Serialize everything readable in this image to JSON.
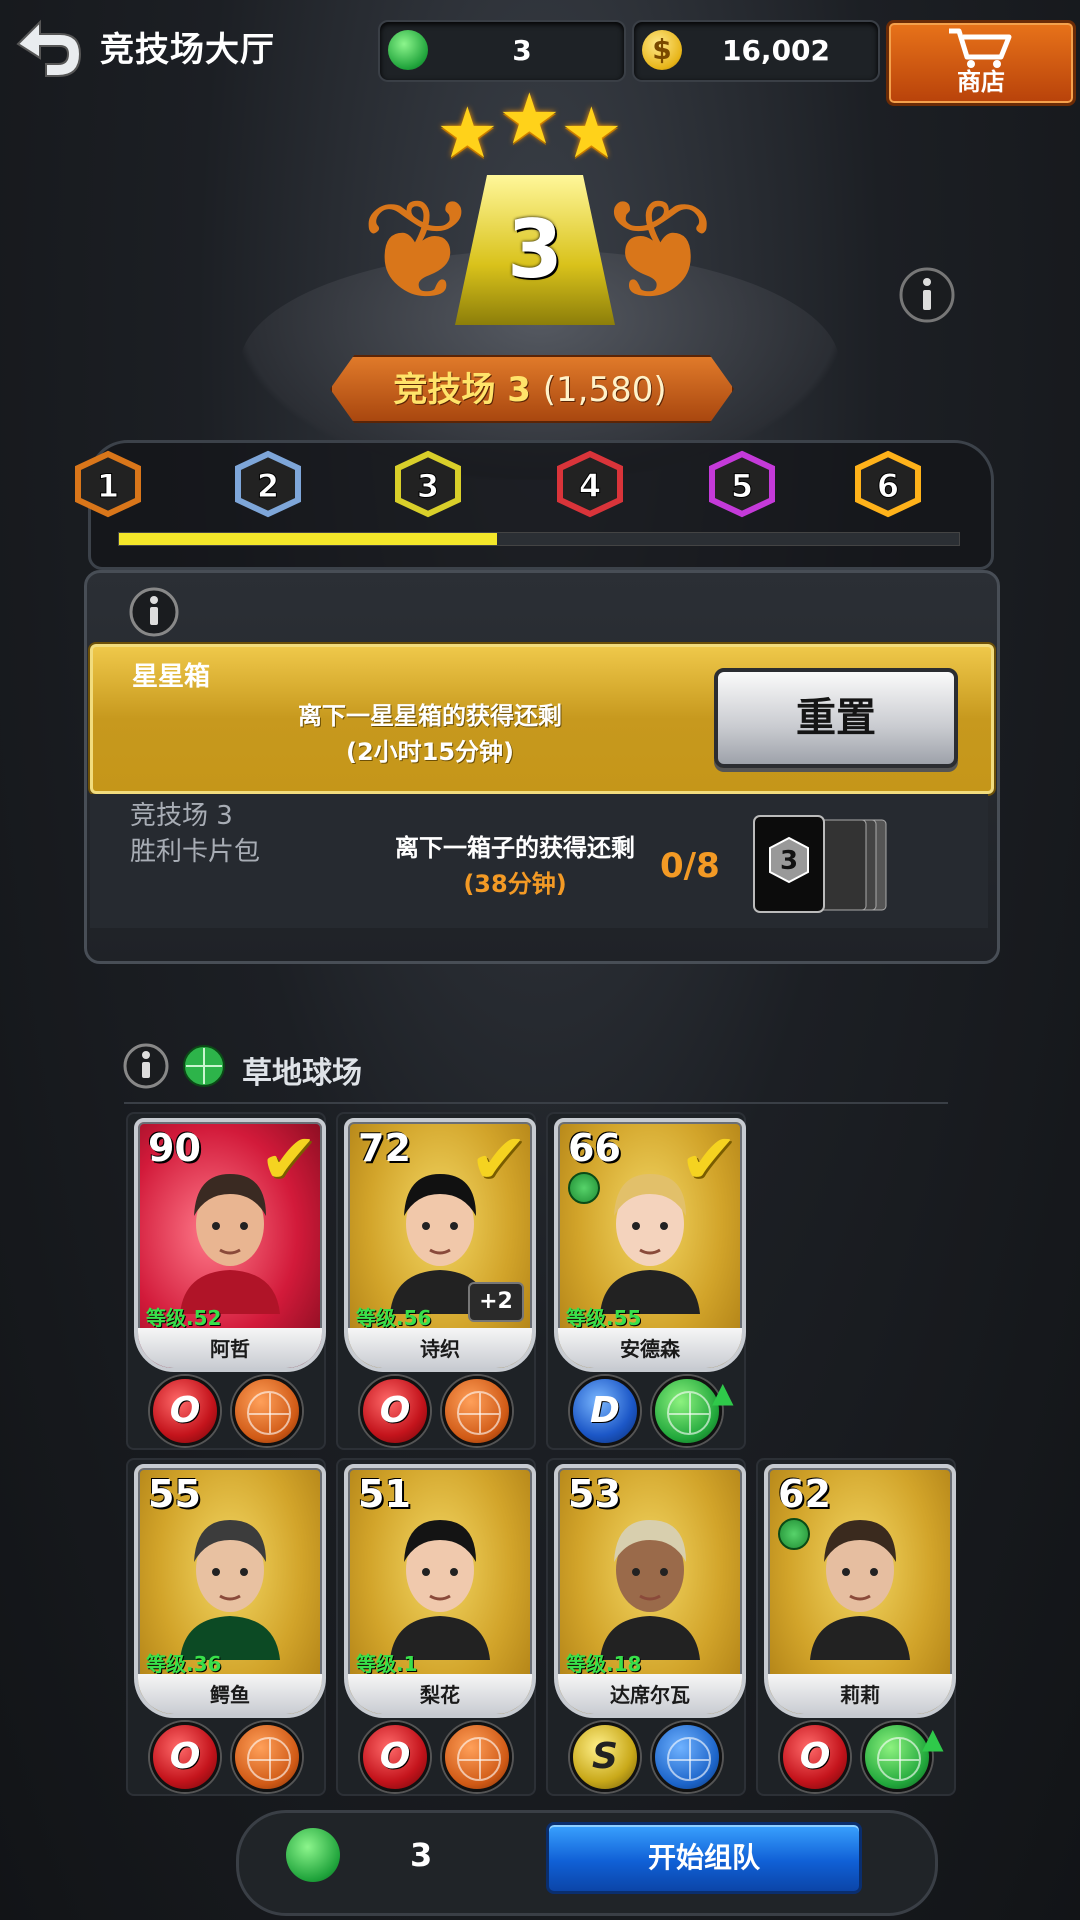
{
  "header": {
    "title": "竞技场大厅",
    "energy": "3",
    "gold": "16,002",
    "shop_label": "商店"
  },
  "arena": {
    "stars": 3,
    "rank": "3",
    "banner_name": "竞技场 3",
    "banner_points": "(1,580)",
    "tiers": [
      "1",
      "2",
      "3",
      "4",
      "5",
      "6"
    ],
    "current_tier": 3,
    "progress": 0.45
  },
  "star_box": {
    "title": "星星箱",
    "message_line1": "离下一星星箱的获得还剩",
    "message_line2": "(2小时15分钟)",
    "reset_label": "重置"
  },
  "victory_pack": {
    "title_line1": "竞技场 3",
    "title_line2": "胜利卡片包",
    "message_line1": "离下一箱子的获得还剩",
    "message_line2": "(38分钟)",
    "count": "0/8",
    "card_rank": "3"
  },
  "court": {
    "title": "草地球场"
  },
  "players": [
    {
      "ovr": "90",
      "level": "等级.52",
      "name": "阿哲",
      "selected": true,
      "style": "O",
      "surface": "clay"
    },
    {
      "ovr": "72",
      "level": "等级.56",
      "name": "诗织",
      "selected": true,
      "extra": "+2",
      "style": "O",
      "surface": "clay"
    },
    {
      "ovr": "66",
      "level": "等级.55",
      "name": "安德森",
      "selected": true,
      "style": "D",
      "surface": "grass"
    },
    {
      "ovr": "55",
      "level": "等级.36",
      "name": "鳄鱼",
      "selected": false,
      "style": "O",
      "surface": "clay"
    },
    {
      "ovr": "51",
      "level": "等级.1",
      "name": "梨花",
      "selected": false,
      "style": "O",
      "surface": "clay"
    },
    {
      "ovr": "53",
      "level": "等级.18",
      "name": "达席尔瓦",
      "selected": false,
      "style": "S",
      "surface": "hard"
    },
    {
      "ovr": "62",
      "level": "",
      "name": "莉莉",
      "selected": false,
      "style": "O",
      "surface": "grass"
    }
  ],
  "footer": {
    "energy": "3",
    "start_label": "开始组队"
  },
  "colors": {
    "accent_gold": "#f4e72a",
    "shop_orange": "#e8731a",
    "start_blue": "#1060d6",
    "timer_orange": "#f39a25",
    "level_green": "#38e04a"
  }
}
